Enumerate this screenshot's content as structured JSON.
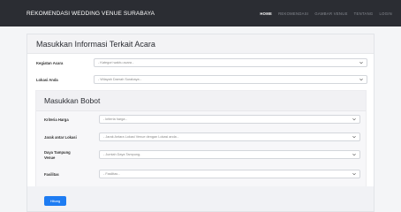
{
  "navbar": {
    "brand": "REKOMENDASI WEDDING VENUE SURABAYA",
    "links": [
      "HOME",
      "REKOMENDASI",
      "GAMBAR VENUE",
      "TENTANG",
      "LOGIN"
    ]
  },
  "form": {
    "title": "Masukkan Informasi Terkait Acara",
    "fields": [
      {
        "label": "Kegiatan Acara",
        "value": "- Kategori waktu acara -"
      },
      {
        "label": "Lokasi Anda",
        "value": "- Wilayah Daerah Surabaya -"
      }
    ]
  },
  "bobot": {
    "title": "Masukkan Bobot",
    "fields": [
      {
        "label": "Kriteria Harga",
        "value": "- kriteria harga -"
      },
      {
        "label": "Jarak antar Lokasi",
        "value": "- Jarak Antara Lokasi Venue dengan Lokasi anda -"
      },
      {
        "label_line1": "Daya Tampung",
        "label_line2": "Venue",
        "value": "- Jumlah Daya Tampung-"
      },
      {
        "label": "Fasilitas",
        "value": "- Fasilitas -"
      }
    ]
  },
  "button": {
    "label": "Hitung"
  },
  "colors": {
    "navbar": "#2b2d33",
    "button": "#1e7cf2"
  },
  "icons": {
    "select": "chevron-down-icon"
  }
}
